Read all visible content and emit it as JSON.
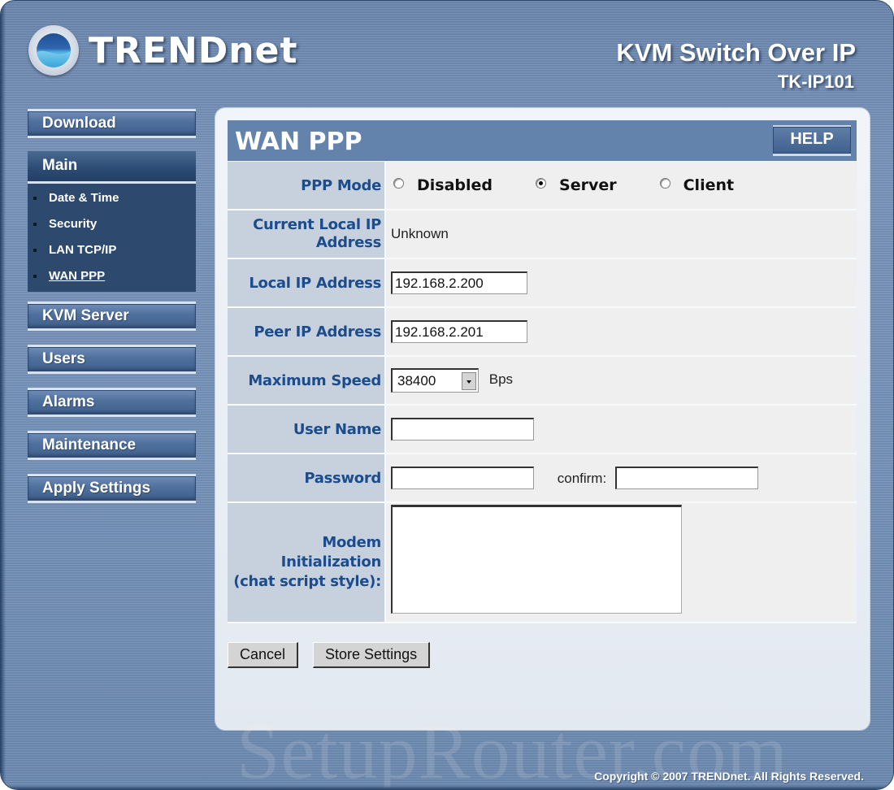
{
  "header": {
    "brand": "TRENDnet",
    "product_title": "KVM Switch Over IP",
    "product_model": "TK-IP101"
  },
  "sidebar": {
    "download": "Download",
    "main": {
      "label": "Main",
      "items": [
        {
          "label": "Date & Time",
          "active": false
        },
        {
          "label": "Security",
          "active": false
        },
        {
          "label": "LAN TCP/IP",
          "active": false
        },
        {
          "label": "WAN PPP",
          "active": true
        }
      ]
    },
    "kvm_server": "KVM Server",
    "users": "Users",
    "alarms": "Alarms",
    "maintenance": "Maintenance",
    "apply_settings": "Apply Settings"
  },
  "page": {
    "title": "WAN PPP",
    "help": "HELP"
  },
  "form": {
    "ppp_mode": {
      "label": "PPP Mode",
      "options": [
        "Disabled",
        "Server",
        "Client"
      ],
      "selected": "Server"
    },
    "current_local_ip": {
      "label": "Current Local IP Address",
      "value": "Unknown"
    },
    "local_ip": {
      "label": "Local IP Address",
      "value": "192.168.2.200"
    },
    "peer_ip": {
      "label": "Peer IP Address",
      "value": "192.168.2.201"
    },
    "max_speed": {
      "label": "Maximum Speed",
      "value": "38400",
      "unit": "Bps"
    },
    "user_name": {
      "label": "User Name",
      "value": ""
    },
    "password": {
      "label": "Password",
      "value": "",
      "confirm_label": "confirm:",
      "confirm_value": ""
    },
    "modem_init": {
      "label_line1": "Modem",
      "label_line2": "Initialization",
      "label_line3": "(chat script style):",
      "value": ""
    }
  },
  "actions": {
    "cancel": "Cancel",
    "store": "Store Settings"
  },
  "footer": {
    "copyright": "Copyright © 2007 TRENDnet. All Rights Reserved.",
    "watermark": "SetupRouter.com"
  }
}
